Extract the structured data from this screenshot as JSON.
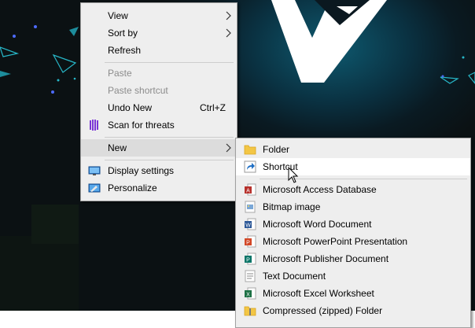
{
  "context_menu": {
    "items": [
      {
        "label": "View"
      },
      {
        "label": "Sort by"
      },
      {
        "label": "Refresh"
      },
      {
        "label": "Paste"
      },
      {
        "label": "Paste shortcut"
      },
      {
        "label": "Undo New",
        "accel": "Ctrl+Z"
      },
      {
        "label": "Scan for threats",
        "icon": "antivirus-scan-icon"
      },
      {
        "label": "New"
      },
      {
        "label": "Display settings",
        "icon": "display-settings-icon"
      },
      {
        "label": "Personalize",
        "icon": "personalize-icon"
      }
    ]
  },
  "new_submenu": {
    "items": [
      {
        "label": "Folder",
        "icon": "folder-icon"
      },
      {
        "label": "Shortcut",
        "icon": "shortcut-icon"
      },
      {
        "label": "Microsoft Access Database",
        "icon": "access-icon"
      },
      {
        "label": "Bitmap image",
        "icon": "bitmap-icon"
      },
      {
        "label": "Microsoft Word Document",
        "icon": "word-icon"
      },
      {
        "label": "Microsoft PowerPoint Presentation",
        "icon": "powerpoint-icon"
      },
      {
        "label": "Microsoft Publisher Document",
        "icon": "publisher-icon"
      },
      {
        "label": "Text Document",
        "icon": "text-document-icon"
      },
      {
        "label": "Microsoft Excel Worksheet",
        "icon": "excel-icon"
      },
      {
        "label": "Compressed (zipped) Folder",
        "icon": "zip-folder-icon"
      }
    ]
  },
  "colors": {
    "menu_bg": "#eeeeee",
    "hover_bg": "#ffffff",
    "disabled_text": "#8c8c8c",
    "wallpaper_accent": "#0e5a70"
  }
}
